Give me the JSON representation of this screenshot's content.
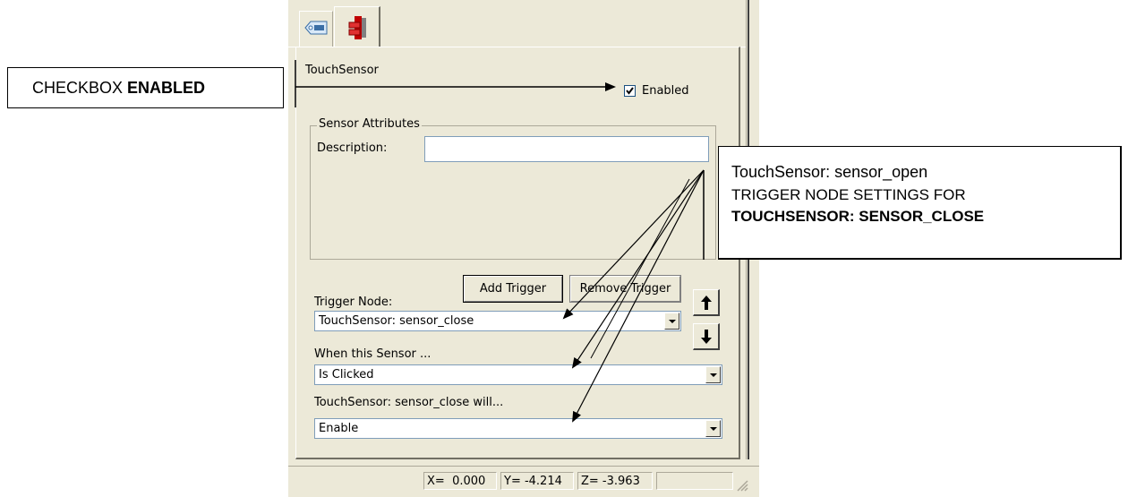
{
  "callout_left": {
    "text_plain": "CHECKBOX ",
    "text_bold": "ENABLED"
  },
  "callout_right": {
    "line1": "TouchSensor: sensor_open",
    "line2": "TRIGGER NODE SETTINGS FOR",
    "line3": "TOUCHSENSOR: SENSOR_CLOSE"
  },
  "tabs": [
    {
      "icon": "node-tag-icon"
    },
    {
      "icon": "touch-sensor-icon"
    }
  ],
  "node": {
    "name": "TouchSensor",
    "enabled_label": "Enabled",
    "enabled_checked": true
  },
  "sensor_attributes": {
    "group_label": "Sensor Attributes",
    "description_label": "Description:",
    "description_value": ""
  },
  "trigger": {
    "node_label": "Trigger Node:",
    "add_button": "Add Trigger",
    "remove_button": "Remove Trigger",
    "node_value": "TouchSensor:  sensor_close",
    "when_label": "When this Sensor ...",
    "when_value": "Is Clicked",
    "action_label": "TouchSensor:  sensor_close will...",
    "action_value": "Enable"
  },
  "status": {
    "x": "X=  0.000",
    "y": "Y= -4.214",
    "z": "Z= -3.963"
  }
}
